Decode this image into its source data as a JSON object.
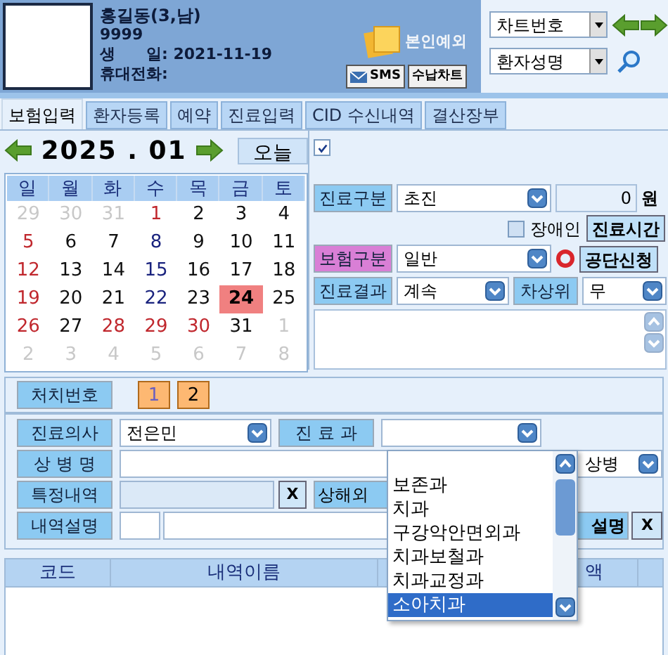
{
  "patient": {
    "name": "홍길동(3,남)",
    "chart_no": "9999",
    "birth": "생　　일: 2021-11-19",
    "phone": "휴대전화:"
  },
  "exception": {
    "label": "본인예외",
    "disabled": true
  },
  "header_buttons": [
    "SMS",
    "수납차트"
  ],
  "search": {
    "fields": [
      "차트번호",
      "환자성명"
    ]
  },
  "tabs": [
    {
      "label": "보험입력",
      "selected": true
    },
    {
      "label": "환자등록",
      "selected": false
    },
    {
      "label": "예약",
      "selected": false
    },
    {
      "label": "진료입력",
      "selected": false
    },
    {
      "label": "CID 수신내역",
      "selected": false
    },
    {
      "label": "결산장부",
      "selected": false
    }
  ],
  "calendar": {
    "month": "2025 . 01",
    "today_button": "오늘",
    "weekdays": [
      "일",
      "월",
      "화",
      "수",
      "목",
      "금",
      "토"
    ],
    "weeks": [
      [
        {
          "day": "29",
          "kind": "other"
        },
        {
          "day": "30",
          "kind": "other"
        },
        {
          "day": "31",
          "kind": "other"
        },
        {
          "day": "1",
          "kind": "holiday"
        },
        {
          "day": "2",
          "kind": "normal"
        },
        {
          "day": "3",
          "kind": "normal"
        },
        {
          "day": "4",
          "kind": "normal"
        }
      ],
      [
        {
          "day": "5",
          "kind": "holiday"
        },
        {
          "day": "6",
          "kind": "normal"
        },
        {
          "day": "7",
          "kind": "normal"
        },
        {
          "day": "8",
          "kind": "marked"
        },
        {
          "day": "9",
          "kind": "normal"
        },
        {
          "day": "10",
          "kind": "normal"
        },
        {
          "day": "11",
          "kind": "normal"
        }
      ],
      [
        {
          "day": "12",
          "kind": "holiday"
        },
        {
          "day": "13",
          "kind": "normal"
        },
        {
          "day": "14",
          "kind": "normal"
        },
        {
          "day": "15",
          "kind": "marked"
        },
        {
          "day": "16",
          "kind": "normal"
        },
        {
          "day": "17",
          "kind": "normal"
        },
        {
          "day": "18",
          "kind": "normal"
        }
      ],
      [
        {
          "day": "19",
          "kind": "holiday"
        },
        {
          "day": "20",
          "kind": "normal"
        },
        {
          "day": "21",
          "kind": "normal"
        },
        {
          "day": "22",
          "kind": "marked"
        },
        {
          "day": "23",
          "kind": "normal"
        },
        {
          "day": "24",
          "kind": "selected"
        },
        {
          "day": "25",
          "kind": "normal"
        }
      ],
      [
        {
          "day": "26",
          "kind": "holiday"
        },
        {
          "day": "27",
          "kind": "normal"
        },
        {
          "day": "28",
          "kind": "holiday"
        },
        {
          "day": "29",
          "kind": "holiday"
        },
        {
          "day": "30",
          "kind": "holiday"
        },
        {
          "day": "31",
          "kind": "normal"
        },
        {
          "day": "1",
          "kind": "other"
        }
      ],
      [
        {
          "day": "2",
          "kind": "other"
        },
        {
          "day": "3",
          "kind": "other"
        },
        {
          "day": "4",
          "kind": "other"
        },
        {
          "day": "5",
          "kind": "other"
        },
        {
          "day": "6",
          "kind": "other"
        },
        {
          "day": "7",
          "kind": "other"
        },
        {
          "day": "8",
          "kind": "other"
        }
      ]
    ]
  },
  "memo_checkbox": {
    "checked": true
  },
  "visit": {
    "type_label": "진료구분",
    "type_value": "초진",
    "amount": "0",
    "currency": "원",
    "disabled_checkbox": {
      "label": "장애인",
      "checked": false
    },
    "time_button": "진료시간",
    "insurance_label": "보험구분",
    "insurance_value": "일반",
    "apply_button": "공단신청",
    "result_label": "진료결과",
    "result_value": "계속",
    "low_income_label": "차상위",
    "low_income_value": "무"
  },
  "treatment": {
    "label": "처치번호",
    "numbers": [
      {
        "label": "1",
        "selected": true
      },
      {
        "label": "2",
        "selected": false
      }
    ]
  },
  "doctor": {
    "label": "진료의사",
    "value": "전은민"
  },
  "department": {
    "label": "진 료 과",
    "expanded": true,
    "options": [
      {
        "label": "보존과",
        "selected": false
      },
      {
        "label": "치과",
        "selected": false
      },
      {
        "label": "구강악안면외과",
        "selected": false
      },
      {
        "label": "치과보철과",
        "selected": false
      },
      {
        "label": "치과교정과",
        "selected": false
      },
      {
        "label": "소아치과",
        "selected": true
      }
    ]
  },
  "diagnosis": {
    "label": "상 병 명",
    "side_select": "상병"
  },
  "special": {
    "label": "특정내역",
    "clear_button": "X",
    "injury_button": "상해외"
  },
  "description": {
    "label": "내역설명",
    "button": "설명",
    "clear_button": "X"
  },
  "table": {
    "columns": [
      "코드",
      "내역이름",
      "액"
    ]
  }
}
